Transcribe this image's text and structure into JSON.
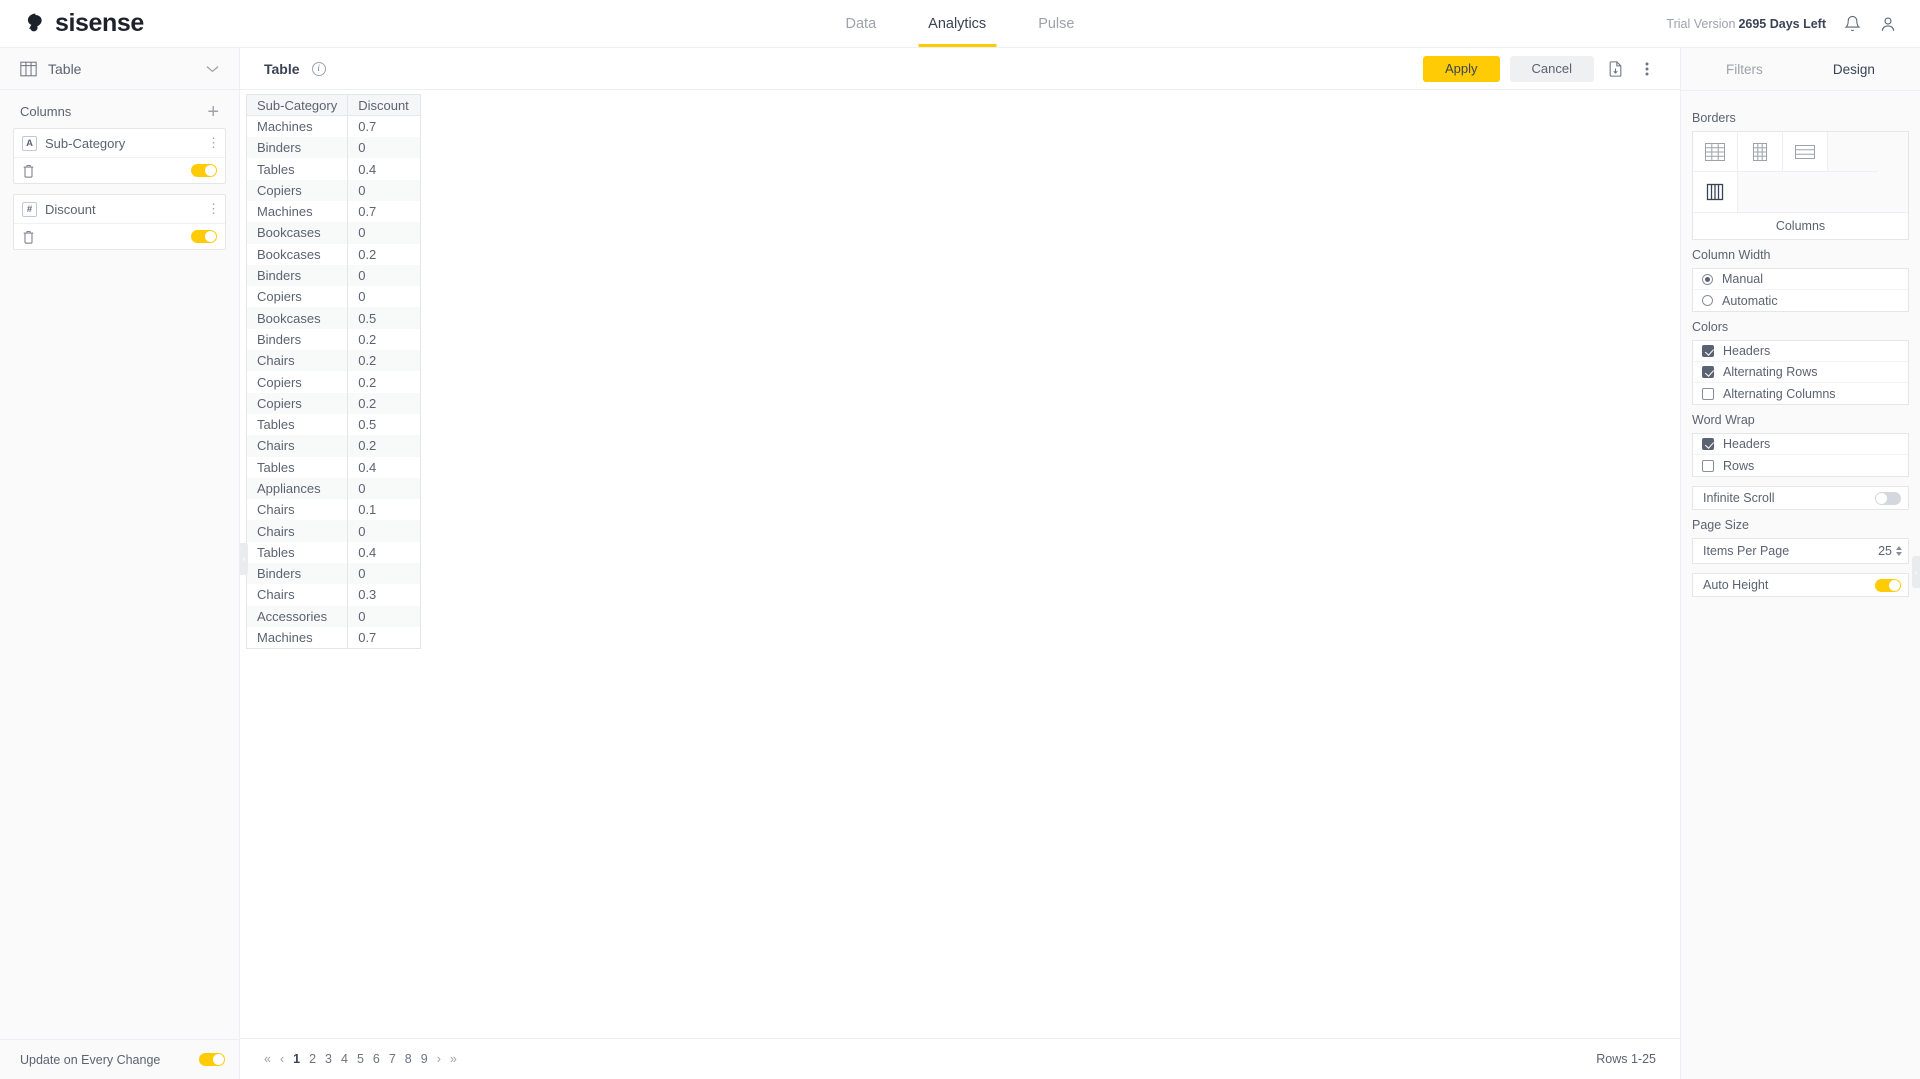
{
  "topbar": {
    "logo_text": "sisense",
    "nav": [
      {
        "label": "Data",
        "active": false
      },
      {
        "label": "Analytics",
        "active": true
      },
      {
        "label": "Pulse",
        "active": false
      }
    ],
    "trial_label": "Trial Version",
    "trial_days": "2695 Days Left",
    "bell_icon": "bell-icon",
    "user_icon": "user-icon"
  },
  "left_panel": {
    "widget_type": "Table",
    "widget_type_icon": "table-icon",
    "columns_title": "Columns",
    "add_icon": "plus-icon",
    "columns": [
      {
        "type_badge": "A",
        "name": "Sub-Category",
        "enabled": true
      },
      {
        "type_badge": "#",
        "name": "Discount",
        "enabled": true
      }
    ],
    "footer_label": "Update on Every Change",
    "footer_toggle": true
  },
  "center": {
    "title": "Table",
    "info_icon": "info-icon",
    "apply_label": "Apply",
    "cancel_label": "Cancel",
    "export_icon": "export-icon",
    "more_icon": "kebab-menu-icon",
    "collapse_icon": "chevron-left-icon",
    "pagination": {
      "first": "«",
      "prev": "‹",
      "pages": [
        "1",
        "2",
        "3",
        "4",
        "5",
        "6",
        "7",
        "8",
        "9"
      ],
      "current": "1",
      "next": "›",
      "last": "»"
    },
    "rows_label": "Rows 1-25"
  },
  "table_data": {
    "type": "table",
    "columns": [
      "Sub-Category",
      "Discount"
    ],
    "rows": [
      [
        "Machines",
        "0.7"
      ],
      [
        "Binders",
        "0"
      ],
      [
        "Tables",
        "0.4"
      ],
      [
        "Copiers",
        "0"
      ],
      [
        "Machines",
        "0.7"
      ],
      [
        "Bookcases",
        "0"
      ],
      [
        "Bookcases",
        "0.2"
      ],
      [
        "Binders",
        "0"
      ],
      [
        "Copiers",
        "0"
      ],
      [
        "Bookcases",
        "0.5"
      ],
      [
        "Binders",
        "0.2"
      ],
      [
        "Chairs",
        "0.2"
      ],
      [
        "Copiers",
        "0.2"
      ],
      [
        "Copiers",
        "0.2"
      ],
      [
        "Tables",
        "0.5"
      ],
      [
        "Chairs",
        "0.2"
      ],
      [
        "Tables",
        "0.4"
      ],
      [
        "Appliances",
        "0"
      ],
      [
        "Chairs",
        "0.1"
      ],
      [
        "Chairs",
        "0"
      ],
      [
        "Tables",
        "0.4"
      ],
      [
        "Binders",
        "0"
      ],
      [
        "Chairs",
        "0.3"
      ],
      [
        "Accessories",
        "0"
      ],
      [
        "Machines",
        "0.7"
      ]
    ]
  },
  "right_panel": {
    "tabs": [
      {
        "label": "Filters",
        "active": false
      },
      {
        "label": "Design",
        "active": true
      }
    ],
    "borders": {
      "title": "Borders",
      "options": [
        "borders-all-icon",
        "borders-vertical-icon",
        "borders-horizontal-icon",
        "borders-columns-icon"
      ],
      "selected_label": "Columns"
    },
    "column_width": {
      "title": "Column Width",
      "options": [
        {
          "label": "Manual",
          "selected": true
        },
        {
          "label": "Automatic",
          "selected": false
        }
      ]
    },
    "colors": {
      "title": "Colors",
      "options": [
        {
          "label": "Headers",
          "checked": true
        },
        {
          "label": "Alternating Rows",
          "checked": true
        },
        {
          "label": "Alternating Columns",
          "checked": false
        }
      ]
    },
    "word_wrap": {
      "title": "Word Wrap",
      "options": [
        {
          "label": "Headers",
          "checked": true
        },
        {
          "label": "Rows",
          "checked": false
        }
      ]
    },
    "infinite_scroll": {
      "label": "Infinite Scroll",
      "on": false
    },
    "page_size": {
      "title": "Page Size",
      "items_label": "Items Per Page",
      "items_value": "25"
    },
    "auto_height": {
      "label": "Auto Height",
      "on": true
    },
    "collapse_icon": "chevron-right-icon"
  },
  "colors": {
    "accent": "#ffcb05",
    "text": "#5b6372",
    "muted": "#9ea2ab",
    "border": "#e4e6ea"
  }
}
